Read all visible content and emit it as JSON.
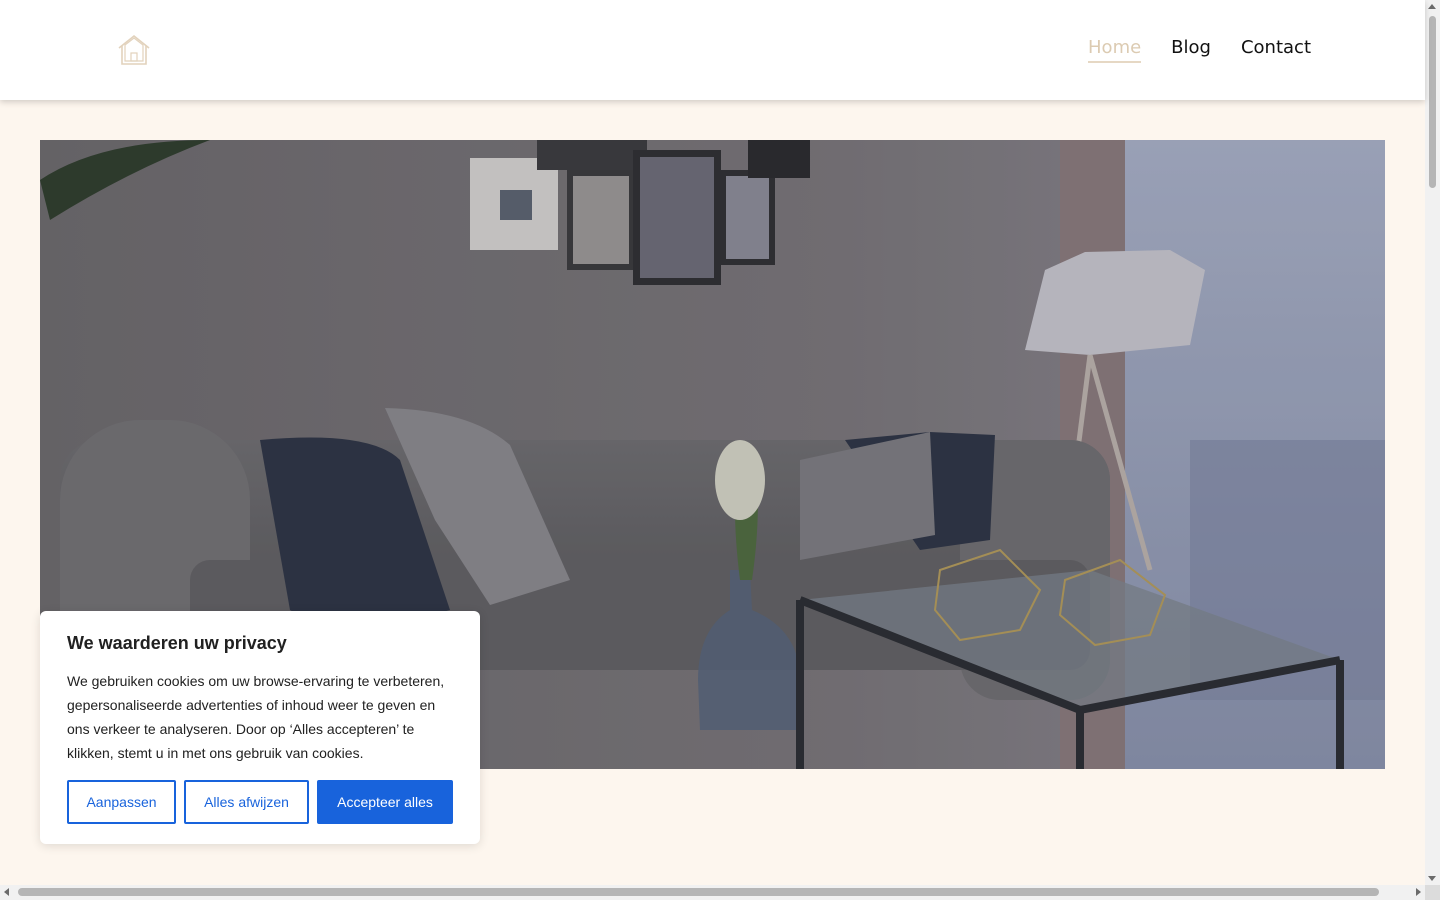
{
  "header": {
    "logo_icon": "house-icon",
    "nav": [
      {
        "label": "Home",
        "active": true
      },
      {
        "label": "Blog",
        "active": false
      },
      {
        "label": "Contact",
        "active": false
      }
    ]
  },
  "hero": {
    "image": "living-room-photo"
  },
  "cookie_banner": {
    "title": "We waarderen uw privacy",
    "body": "We gebruiken cookies om uw browse-ervaring te verbeteren, gepersonaliseerde advertenties of inhoud weer te geven en ons verkeer te analyseren. Door op ‘Alles accepteren’ te klikken, stemt u in met ons gebruik van cookies.",
    "buttons": {
      "customize": "Aanpassen",
      "reject": "Alles afwijzen",
      "accept": "Accepteer alles"
    }
  },
  "colors": {
    "page_bg": "#fdf6ee",
    "accent_nav": "#dccbb2",
    "button_blue": "#1863dc"
  }
}
